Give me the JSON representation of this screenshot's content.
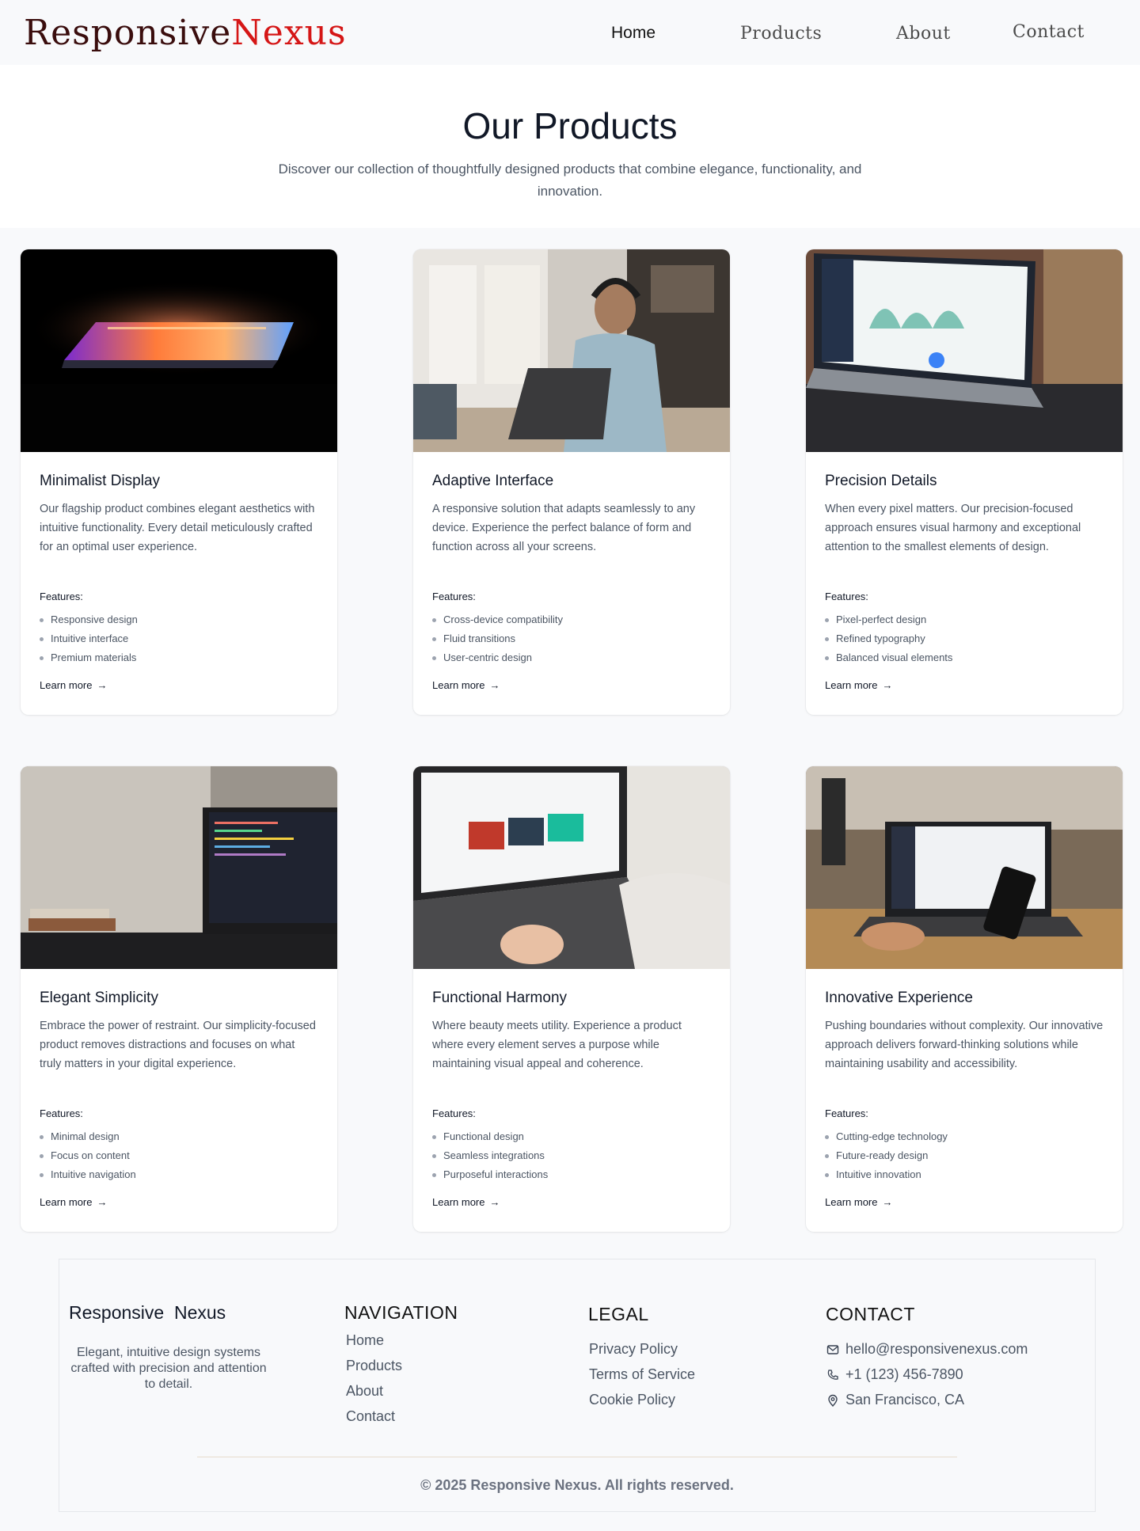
{
  "header": {
    "logo_part1": "Responsive",
    "logo_part2": "Nexus",
    "nav": [
      "Home",
      "Products",
      "About",
      "Contact"
    ]
  },
  "hero": {
    "title": "Our Products",
    "subtitle": "Discover our collection of thoughtfully designed products that combine elegance, functionality, and innovation."
  },
  "products": [
    {
      "title": "Minimalist Display",
      "description": "Our flagship product combines elegant aesthetics with intuitive functionality. Every detail meticulously crafted for an optimal user experience.",
      "features_label": "Features:",
      "features": [
        "Responsive design",
        "Intuitive interface",
        "Premium materials"
      ],
      "link": "Learn more"
    },
    {
      "title": "Adaptive Interface",
      "description": "A responsive solution that adapts seamlessly to any device. Experience the perfect balance of form and function across all your screens.",
      "features_label": "Features:",
      "features": [
        "Cross-device compatibility",
        "Fluid transitions",
        "User-centric design"
      ],
      "link": "Learn more"
    },
    {
      "title": "Precision Details",
      "description": "When every pixel matters. Our precision-focused approach ensures visual harmony and exceptional attention to the smallest elements of design.",
      "features_label": "Features:",
      "features": [
        "Pixel-perfect design",
        "Refined typography",
        "Balanced visual elements"
      ],
      "link": "Learn more"
    },
    {
      "title": "Elegant Simplicity",
      "description": "Embrace the power of restraint. Our simplicity-focused product removes distractions and focuses on what truly matters in your digital experience.",
      "features_label": "Features:",
      "features": [
        "Minimal design",
        "Focus on content",
        "Intuitive navigation"
      ],
      "link": "Learn more"
    },
    {
      "title": "Functional Harmony",
      "description": "Where beauty meets utility. Experience a product where every element serves a purpose while maintaining visual appeal and coherence.",
      "features_label": "Features:",
      "features": [
        "Functional design",
        "Seamless integrations",
        "Purposeful interactions"
      ],
      "link": "Learn more"
    },
    {
      "title": "Innovative Experience",
      "description": "Pushing boundaries without complexity. Our innovative approach delivers forward-thinking solutions while maintaining usability and accessibility.",
      "features_label": "Features:",
      "features": [
        "Cutting-edge technology",
        "Future-ready design",
        "Intuitive innovation"
      ],
      "link": "Learn more"
    }
  ],
  "footer": {
    "brand_part1": "Responsive",
    "brand_part2": "Nexus",
    "tagline": "Elegant, intuitive design systems crafted with precision and attention to detail.",
    "navigation_heading": "NAVIGATION",
    "navigation": [
      "Home",
      "Products",
      "About",
      "Contact"
    ],
    "legal_heading": "LEGAL",
    "legal": [
      "Privacy Policy",
      "Terms of Service",
      "Cookie Policy"
    ],
    "contact_heading": "CONTACT",
    "email": "hello@responsivenexus.com",
    "phone": "+1 (123) 456-7890",
    "location": "San Francisco, CA",
    "copyright": "© 2025 Responsive Nexus. All rights reserved."
  },
  "icons": {
    "email": "mail-icon",
    "phone": "phone-icon",
    "location": "map-pin-icon",
    "link_arrow": "arrow-right-icon"
  }
}
